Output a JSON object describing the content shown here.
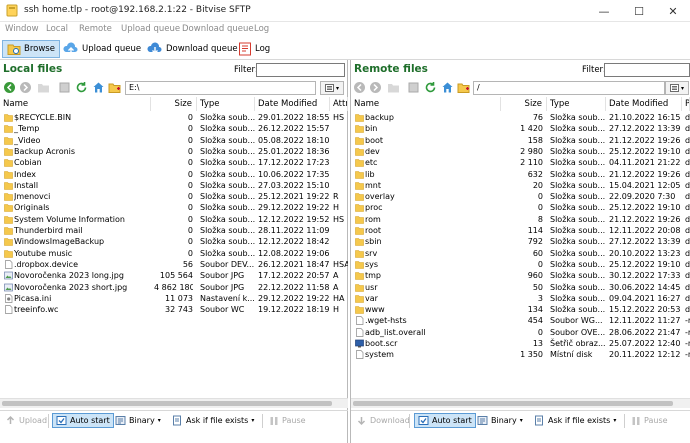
{
  "window": {
    "title": "ssh home.tlp - root@192.168.2.1:22 - Bitvise SFTP",
    "minimize_glyph": "—",
    "maximize_glyph": "☐",
    "close_glyph": "✕"
  },
  "menu": [
    "Window",
    "Local",
    "Remote",
    "Upload queue",
    "Download queue",
    "Log"
  ],
  "toolbar": {
    "browse": "Browse",
    "upload_queue": "Upload queue",
    "download_queue": "Download queue",
    "log": "Log"
  },
  "left": {
    "title": "Local files",
    "filter_label": "Filter:",
    "filter_value": "",
    "path": "E:\\",
    "columns": [
      "Name",
      "Size",
      "Type",
      "Date Modified",
      "Attri"
    ],
    "rows": [
      {
        "name": "$RECYCLE.BIN",
        "size": "0",
        "type": "Složka soub...",
        "date": "29.01.2022 18:55",
        "attr": "HS",
        "icon": "folder-icon"
      },
      {
        "name": "_Temp",
        "size": "0",
        "type": "Složka soub...",
        "date": "26.12.2022 15:57",
        "attr": "",
        "icon": "folder-icon"
      },
      {
        "name": "_Video",
        "size": "0",
        "type": "Složka soub...",
        "date": "05.08.2022 18:10",
        "attr": "",
        "icon": "folder-icon"
      },
      {
        "name": "Backup Acronis",
        "size": "0",
        "type": "Složka soub...",
        "date": "25.01.2022 18:36",
        "attr": "",
        "icon": "folder-icon"
      },
      {
        "name": "Cobian",
        "size": "0",
        "type": "Složka soub...",
        "date": "17.12.2022 17:23",
        "attr": "",
        "icon": "folder-icon"
      },
      {
        "name": "Index",
        "size": "0",
        "type": "Složka soub...",
        "date": "10.06.2022 17:35",
        "attr": "",
        "icon": "folder-icon"
      },
      {
        "name": "Install",
        "size": "0",
        "type": "Složka soub...",
        "date": "27.03.2022 15:10",
        "attr": "",
        "icon": "folder-icon"
      },
      {
        "name": "Jmenovci",
        "size": "0",
        "type": "Složka soub...",
        "date": "25.12.2021 19:22",
        "attr": "R",
        "icon": "folder-icon"
      },
      {
        "name": "Originals",
        "size": "0",
        "type": "Složka soub...",
        "date": "29.12.2022 19:22",
        "attr": "H",
        "icon": "folder-icon"
      },
      {
        "name": "System Volume Information",
        "size": "0",
        "type": "Složka soub...",
        "date": "12.12.2022 19:52",
        "attr": "HS",
        "icon": "folder-icon"
      },
      {
        "name": "Thunderbird mail",
        "size": "0",
        "type": "Složka soub...",
        "date": "28.11.2022 11:09",
        "attr": "",
        "icon": "folder-icon"
      },
      {
        "name": "WindowsImageBackup",
        "size": "0",
        "type": "Složka soub...",
        "date": "12.12.2022 18:42",
        "attr": "",
        "icon": "folder-icon"
      },
      {
        "name": "Youtube music",
        "size": "0",
        "type": "Složka soub...",
        "date": "12.08.2022 19:06",
        "attr": "",
        "icon": "folder-icon"
      },
      {
        "name": ".dropbox.device",
        "size": "56",
        "type": "Soubor DEV...",
        "date": "26.12.2021 18:47",
        "attr": "HSA",
        "icon": "file-icon"
      },
      {
        "name": "Novoročenka 2023 long.jpg",
        "size": "105 564",
        "type": "Soubor JPG",
        "date": "17.12.2022 20:57",
        "attr": "A",
        "icon": "image-icon"
      },
      {
        "name": "Novoročenka 2023 short.jpg",
        "size": "4 862 180",
        "type": "Soubor JPG",
        "date": "22.12.2022 11:58",
        "attr": "A",
        "icon": "image-icon"
      },
      {
        "name": "Picasa.ini",
        "size": "11 073",
        "type": "Nastavení k...",
        "date": "29.12.2022 19:22",
        "attr": "HA",
        "icon": "settings-file-icon"
      },
      {
        "name": "treeinfo.wc",
        "size": "32 743",
        "type": "Soubor WC",
        "date": "19.12.2022 18:19",
        "attr": "H",
        "icon": "file-icon"
      }
    ],
    "footer": {
      "upload": "Upload",
      "auto_start": "Auto start",
      "binary": "Binary",
      "ask_if_exists": "Ask if file exists",
      "pause": "Pause"
    }
  },
  "right": {
    "title": "Remote files",
    "filter_label": "Filter:",
    "filter_value": "",
    "path": "/",
    "columns": [
      "Name",
      "Size",
      "Type",
      "Date Modified",
      "P"
    ],
    "rows": [
      {
        "name": "backup",
        "size": "76",
        "type": "Složka soub...",
        "date": "21.10.2022 16:15",
        "perm": "dr",
        "icon": "folder-icon"
      },
      {
        "name": "bin",
        "size": "1 420",
        "type": "Složka soub...",
        "date": "27.12.2022 13:39",
        "perm": "dr",
        "icon": "folder-icon"
      },
      {
        "name": "boot",
        "size": "158",
        "type": "Složka soub...",
        "date": "21.12.2022 19:26",
        "perm": "dr",
        "icon": "folder-icon"
      },
      {
        "name": "dev",
        "size": "2 980",
        "type": "Složka soub...",
        "date": "25.12.2022 19:10",
        "perm": "dr",
        "icon": "folder-icon"
      },
      {
        "name": "etc",
        "size": "2 110",
        "type": "Složka soub...",
        "date": "04.11.2021 21:22",
        "perm": "dr",
        "icon": "folder-icon"
      },
      {
        "name": "lib",
        "size": "632",
        "type": "Složka soub...",
        "date": "21.12.2022 19:26",
        "perm": "dr",
        "icon": "folder-icon"
      },
      {
        "name": "mnt",
        "size": "20",
        "type": "Složka soub...",
        "date": "15.04.2021 12:05",
        "perm": "dr",
        "icon": "folder-icon"
      },
      {
        "name": "overlay",
        "size": "0",
        "type": "Složka soub...",
        "date": "22.09.2020 7:30",
        "perm": "dr",
        "icon": "folder-icon"
      },
      {
        "name": "proc",
        "size": "0",
        "type": "Složka soub...",
        "date": "25.12.2022 19:10",
        "perm": "dr",
        "icon": "folder-icon"
      },
      {
        "name": "rom",
        "size": "8",
        "type": "Složka soub...",
        "date": "21.12.2022 19:26",
        "perm": "dr",
        "icon": "folder-icon"
      },
      {
        "name": "root",
        "size": "114",
        "type": "Složka soub...",
        "date": "12.11.2022 20:08",
        "perm": "dr",
        "icon": "folder-icon"
      },
      {
        "name": "sbin",
        "size": "792",
        "type": "Složka soub...",
        "date": "27.12.2022 13:39",
        "perm": "dr",
        "icon": "folder-icon"
      },
      {
        "name": "srv",
        "size": "60",
        "type": "Složka soub...",
        "date": "20.10.2022 13:23",
        "perm": "dr",
        "icon": "folder-icon"
      },
      {
        "name": "sys",
        "size": "0",
        "type": "Složka soub...",
        "date": "25.12.2022 19:10",
        "perm": "dr",
        "icon": "folder-icon"
      },
      {
        "name": "tmp",
        "size": "960",
        "type": "Složka soub...",
        "date": "30.12.2022 17:33",
        "perm": "dr",
        "icon": "folder-icon"
      },
      {
        "name": "usr",
        "size": "50",
        "type": "Složka soub...",
        "date": "30.06.2022 14:45",
        "perm": "dr",
        "icon": "folder-icon"
      },
      {
        "name": "var",
        "size": "3",
        "type": "Složka soub...",
        "date": "09.04.2021 16:27",
        "perm": "dr",
        "icon": "folder-icon"
      },
      {
        "name": "www",
        "size": "134",
        "type": "Složka soub...",
        "date": "15.12.2022 20:53",
        "perm": "dr",
        "icon": "folder-icon"
      },
      {
        "name": ".wget-hsts",
        "size": "454",
        "type": "Soubor WG...",
        "date": "12.11.2022 11:27",
        "perm": "-r",
        "icon": "file-icon"
      },
      {
        "name": "adb_list.overall",
        "size": "0",
        "type": "Soubor OVE...",
        "date": "28.06.2022 21:47",
        "perm": "-r",
        "icon": "file-icon"
      },
      {
        "name": "boot.scr",
        "size": "13",
        "type": "Šetřič obraz...",
        "date": "25.07.2022 12:40",
        "perm": "-n",
        "icon": "screensaver-file-icon"
      },
      {
        "name": "system",
        "size": "1 350",
        "type": "Místní disk",
        "date": "20.11.2022 12:12",
        "perm": "-n",
        "icon": "file-icon"
      }
    ],
    "footer": {
      "download": "Download",
      "auto_start": "Auto start",
      "binary": "Binary",
      "ask_if_exists": "Ask if file exists",
      "pause": "Pause"
    }
  },
  "colors": {
    "pane_title": "#1e6e2a",
    "active_button_bg": "#cce4f7",
    "folder": "#f5c84c",
    "disabled_text": "#a8a8a8"
  }
}
